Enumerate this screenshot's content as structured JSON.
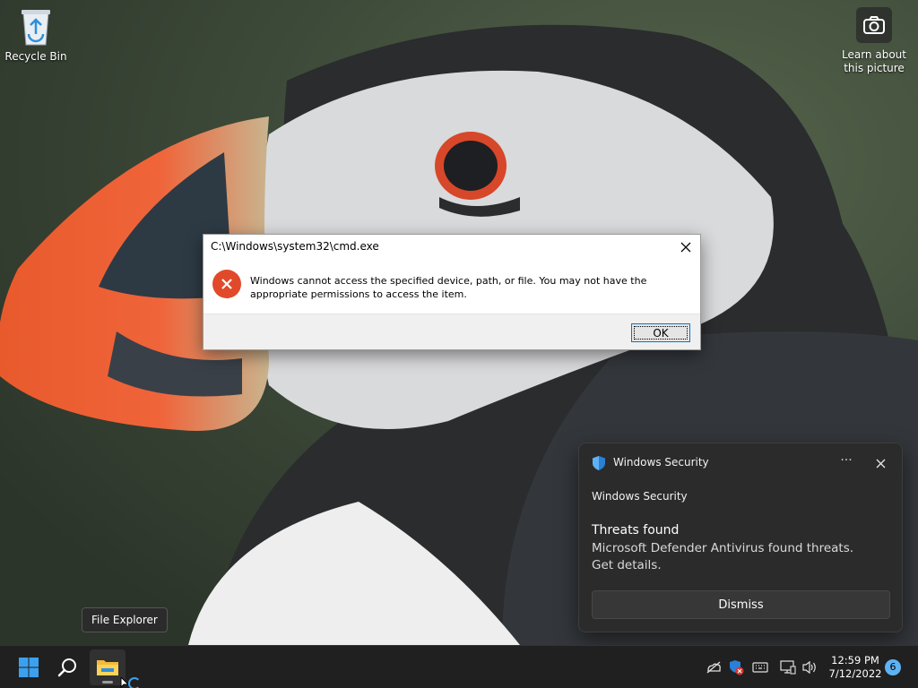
{
  "desktop": {
    "recycle_bin_label": "Recycle Bin",
    "learn_label_line1": "Learn about",
    "learn_label_line2": "this picture"
  },
  "dialog": {
    "title": "C:\\Windows\\system32\\cmd.exe",
    "message": "Windows cannot access the specified device, path, or file. You may not have the appropriate permissions to access the item.",
    "ok_label": "OK",
    "icon": "error-icon"
  },
  "toast": {
    "header_title": "Windows Security",
    "app_name": "Windows Security",
    "heading": "Threats found",
    "body": "Microsoft Defender Antivirus found threats. Get details.",
    "dismiss_label": "Dismiss",
    "more_label": "···"
  },
  "tooltip": {
    "text": "File Explorer"
  },
  "taskbar": {
    "time": "12:59 PM",
    "date": "7/12/2022",
    "notification_count": "6",
    "tray_icons": [
      "network-off-icon",
      "security-warning-icon",
      "keyboard-icon",
      "display-icon",
      "volume-icon"
    ]
  },
  "colors": {
    "error_red": "#e04a2b",
    "accent_blue": "#0078d4",
    "taskbar_bg": "#202020",
    "toast_bg": "#2b2b2b"
  }
}
